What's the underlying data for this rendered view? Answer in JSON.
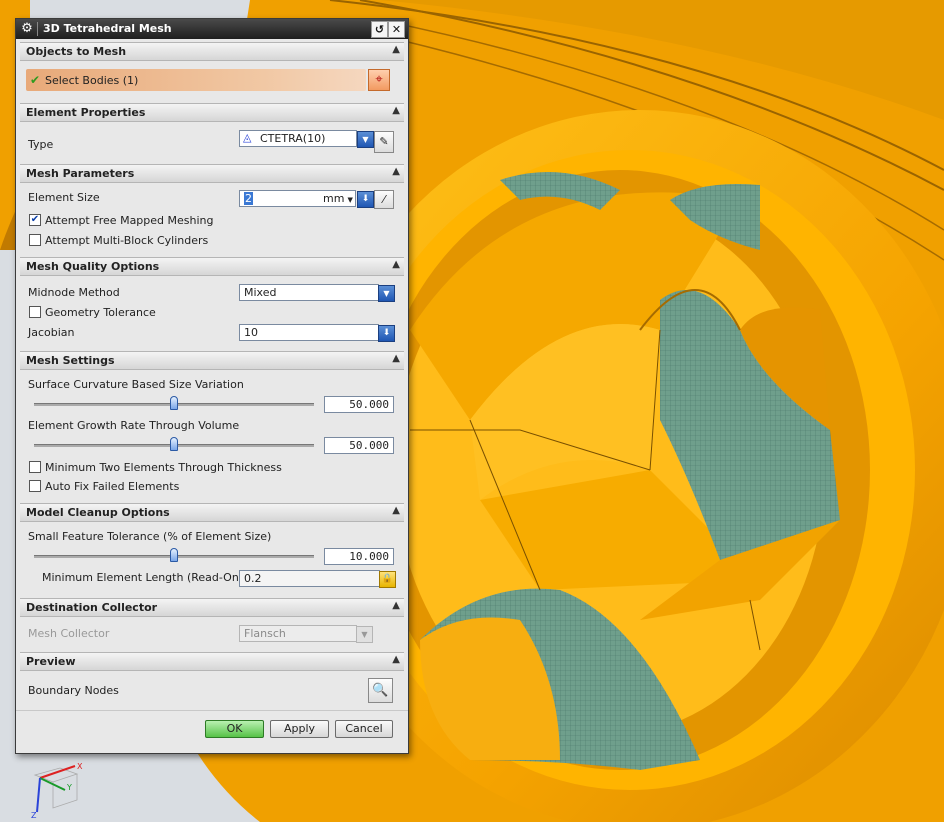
{
  "title": "3D Tetrahedral Mesh",
  "titlebar": {
    "reset_glyph": "↺",
    "close_glyph": "✕"
  },
  "sections": {
    "objects": {
      "header": "Objects to Mesh",
      "select_label": "Select Bodies (1)"
    },
    "element_properties": {
      "header": "Element Properties",
      "type_label": "Type",
      "type_value": "CTETRA(10)"
    },
    "mesh_parameters": {
      "header": "Mesh Parameters",
      "element_size_label": "Element Size",
      "element_size_value": "2",
      "unit": "mm",
      "free_mapped_label": "Attempt Free Mapped Meshing",
      "free_mapped_checked": true,
      "multiblock_label": "Attempt Multi-Block Cylinders",
      "multiblock_checked": false
    },
    "mesh_quality": {
      "header": "Mesh Quality Options",
      "midnode_label": "Midnode Method",
      "midnode_value": "Mixed",
      "geom_tol_label": "Geometry Tolerance",
      "geom_tol_checked": false,
      "jacobian_label": "Jacobian",
      "jacobian_value": "10"
    },
    "mesh_settings": {
      "header": "Mesh Settings",
      "curvature_label": "Surface Curvature Based Size Variation",
      "curvature_value": "50.000",
      "curvature_slider": 0.5,
      "growth_label": "Element Growth Rate Through Volume",
      "growth_value": "50.000",
      "growth_slider": 0.5,
      "min_two_label": "Minimum Two Elements Through Thickness",
      "min_two_checked": false,
      "autofix_label": "Auto Fix Failed Elements",
      "autofix_checked": false
    },
    "cleanup": {
      "header": "Model Cleanup Options",
      "small_feature_label": "Small Feature Tolerance (% of Element Size)",
      "small_feature_value": "10.000",
      "small_feature_slider": 0.5,
      "min_len_label": "Minimum Element Length (Read-Only)",
      "min_len_value": "0.2"
    },
    "destination": {
      "header": "Destination Collector",
      "collector_label": "Mesh Collector",
      "collector_value": "Flansch"
    },
    "preview": {
      "header": "Preview",
      "boundary_label": "Boundary Nodes"
    }
  },
  "buttons": {
    "ok": "OK",
    "apply": "Apply",
    "cancel": "Cancel"
  },
  "axes": {
    "x": "X",
    "y": "Y",
    "z": "Z"
  },
  "colors": {
    "part": "#f7a800",
    "part_shadow": "#c67d00",
    "mesh": "#6f9f8c",
    "background": "#d9dde2"
  }
}
